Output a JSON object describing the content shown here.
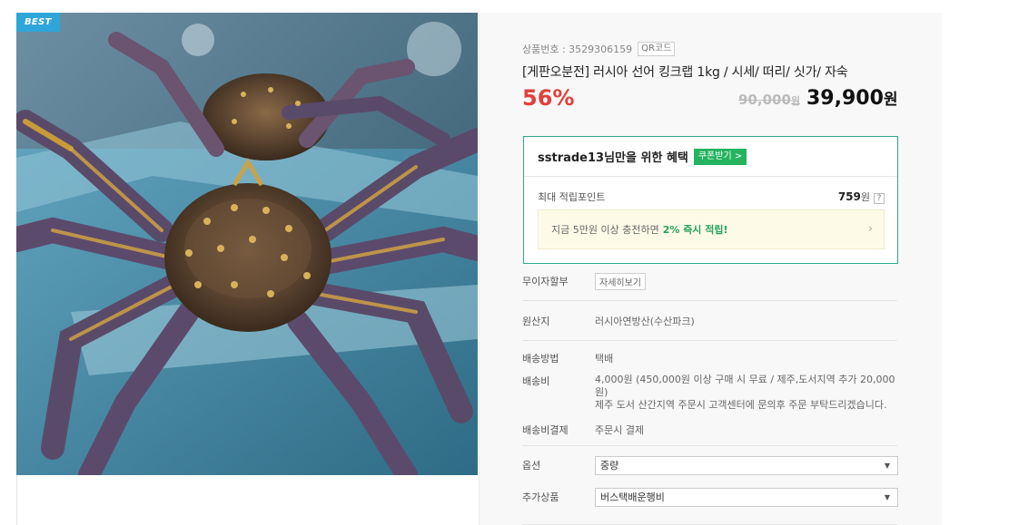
{
  "badge": {
    "label": "BEST",
    "color": "#2fa6d9"
  },
  "product": {
    "code_label": "상품번호 : 3529306159",
    "qr_label": "QR코드",
    "title": "[게판오분전] 러시아 선어 킹크랩 1kg / 시세/ 떠리/ 싯가/ 자숙",
    "discount": "56%",
    "original_price": "90,000",
    "original_unit": "원",
    "sale_price": "39,900",
    "sale_unit": "원",
    "image_icon": "king-crab-photo"
  },
  "benefit": {
    "heading": "sstrade13님만을 위한 혜택",
    "coupon_button": "쿠폰받기 >",
    "point_label": "최대 적립포인트",
    "point_value": "759",
    "point_unit": "원",
    "help_mark": "?",
    "charge_text": "지금 5만원 이상 충전하면",
    "charge_highlight": "2% 즉시 적립!",
    "chevron": "›",
    "border_color": "#2aaa8a",
    "accent_color": "#24b35f"
  },
  "details": {
    "installment_label": "무이자할부",
    "installment_button": "자세히보기",
    "origin_label": "원산지",
    "origin_value": "러시아연방산(수산파크)",
    "shipping_method_label": "배송방법",
    "shipping_method_value": "택배",
    "shipping_fee_label": "배송비",
    "shipping_fee_line1": "4,000원 (450,000원 이상 구매 시 무료 / 제주,도서지역 추가 20,000",
    "shipping_fee_line2": "원)",
    "shipping_fee_line3": "제주 도서 산간지역 주문시 고객센터에 문의후 주문 부탁드리겠습니다.",
    "payment_label": "배송비결제",
    "payment_value": "주문시 결제"
  },
  "options": {
    "option_label": "옵션",
    "option_value": "중량",
    "addon_label": "추가상품",
    "addon_value": "버스택배운행비",
    "arrow": "▼"
  }
}
